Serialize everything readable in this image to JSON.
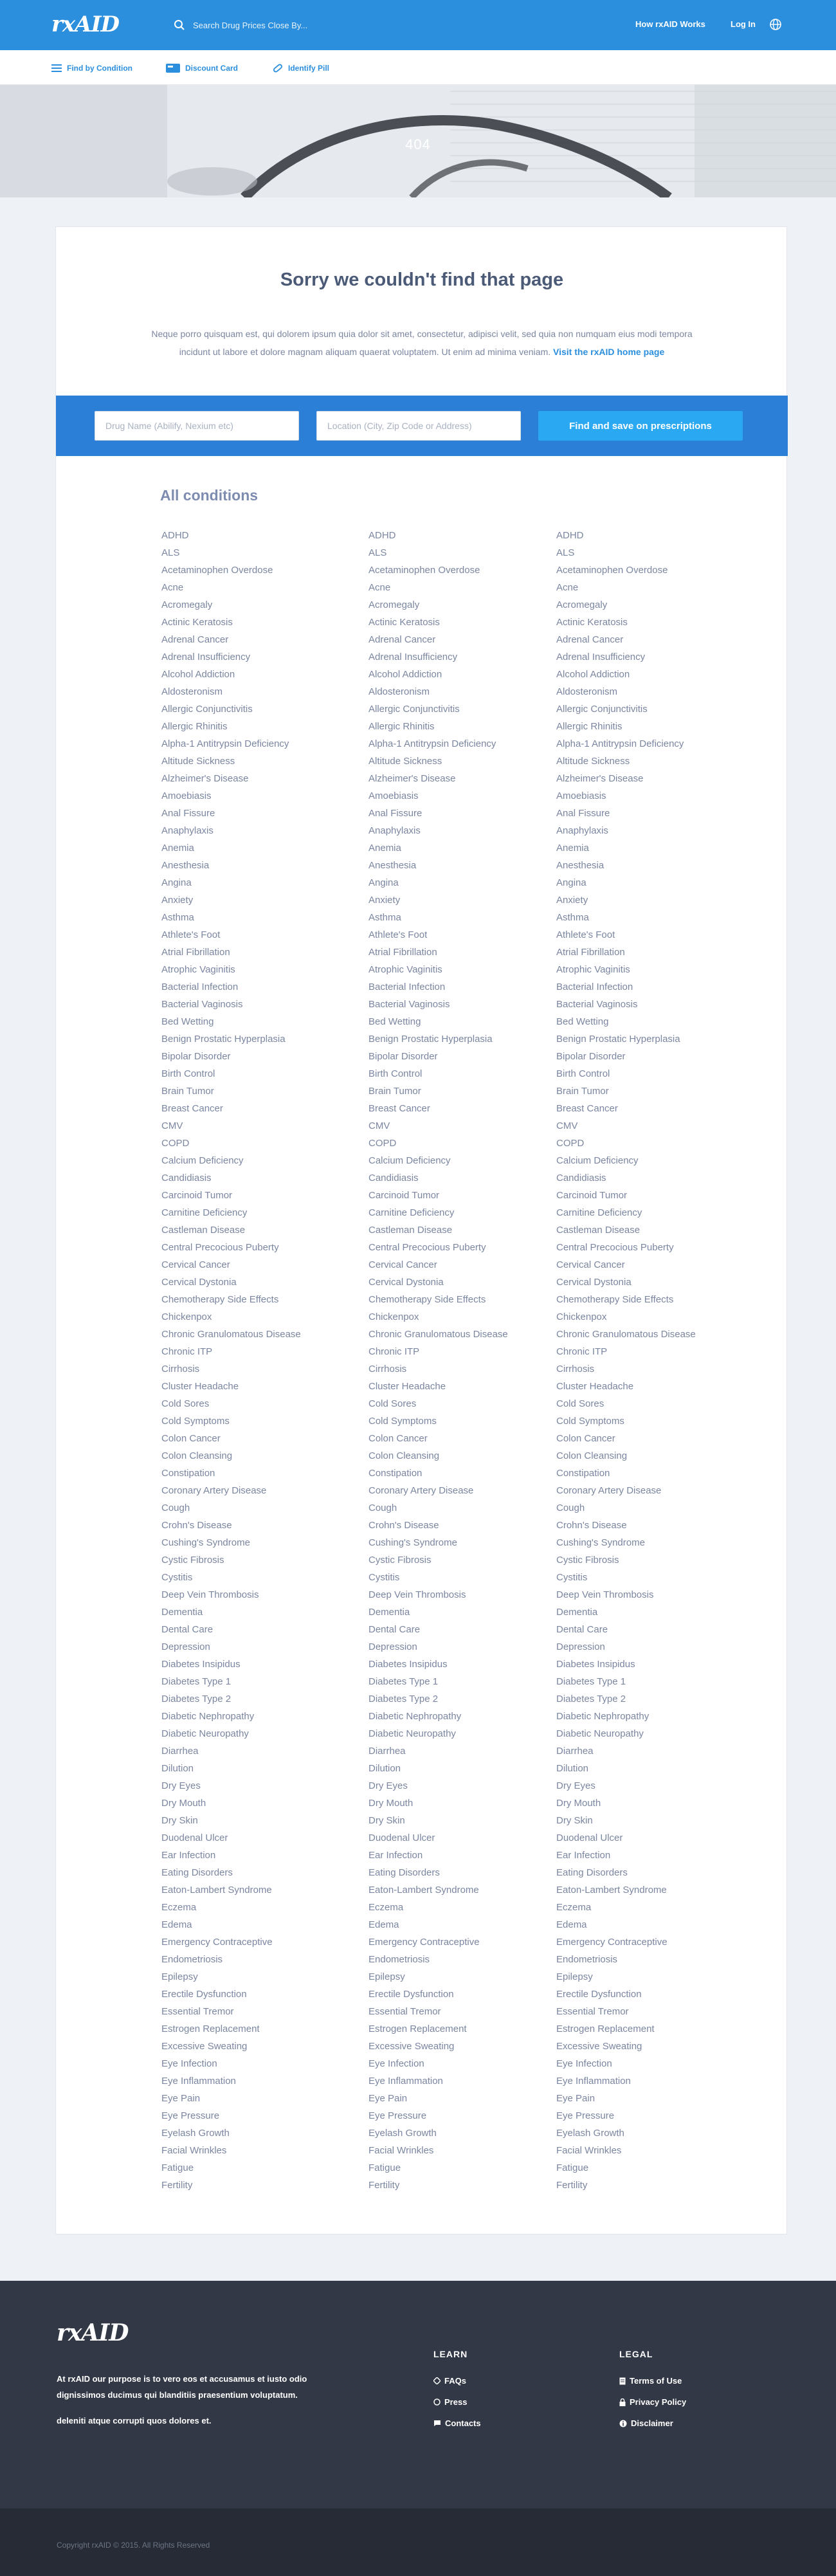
{
  "header": {
    "logo_text": "rxAID",
    "search_placeholder": "Search Drug Prices Close By...",
    "how_it_works": "How rxAID Works",
    "login": "Log In"
  },
  "subnav": {
    "find_by_condition": "Find by Condition",
    "discount_card": "Discount Card",
    "identify_pill": "Identify Pill"
  },
  "hero": {
    "code": "404"
  },
  "main": {
    "title": "Sorry we couldn't find that page",
    "text": "Neque porro quisquam est, qui dolorem ipsum quia dolor sit amet, consectetur, adipisci velit, sed quia non numquam eius modi tempora incidunt ut labore et dolore magnam aliquam quaerat voluptatem. Ut enim ad minima veniam.",
    "home_link": "Visit the rxAID home page"
  },
  "search_band": {
    "drug_placeholder": "Drug Name (Abilify, Nexium etc)",
    "location_placeholder": "Location (City, Zip Code or Address)",
    "button": "Find and save on prescriptions"
  },
  "conditions": {
    "title": "All conditions",
    "items": [
      "ADHD",
      "ALS",
      "Acetaminophen Overdose",
      "Acne",
      "Acromegaly",
      "Actinic Keratosis",
      "Adrenal Cancer",
      "Adrenal Insufficiency",
      "Alcohol Addiction",
      "Aldosteronism",
      "Allergic Conjunctivitis",
      "Allergic Rhinitis",
      "Alpha-1 Antitrypsin Deficiency",
      "Altitude Sickness",
      "Alzheimer's Disease",
      "Amoebiasis",
      "Anal Fissure",
      "Anaphylaxis",
      "Anemia",
      "Anesthesia",
      "Angina",
      "Anxiety",
      "Asthma",
      "Athlete's Foot",
      "Atrial Fibrillation",
      "Atrophic Vaginitis",
      "Bacterial Infection",
      "Bacterial Vaginosis",
      "Bed Wetting",
      "Benign Prostatic Hyperplasia",
      "Bipolar Disorder",
      "Birth Control",
      "Brain Tumor",
      "Breast Cancer",
      "CMV",
      "COPD",
      "Calcium Deficiency",
      "Candidiasis",
      "Carcinoid Tumor",
      "Carnitine Deficiency",
      "Castleman Disease",
      "Central Precocious Puberty",
      "Cervical Cancer",
      "Cervical Dystonia",
      "Chemotherapy Side Effects",
      "Chickenpox",
      "Chronic Granulomatous Disease",
      "Chronic ITP",
      "Cirrhosis",
      "Cluster Headache",
      "Cold Sores",
      "Cold Symptoms",
      "Colon Cancer",
      "Colon Cleansing",
      "Constipation",
      "Coronary Artery Disease",
      "Cough",
      "Crohn's Disease",
      "Cushing's Syndrome",
      "Cystic Fibrosis",
      "Cystitis",
      "Deep Vein Thrombosis",
      "Dementia",
      "Dental Care",
      "Depression",
      "Diabetes Insipidus",
      "Diabetes Type 1",
      "Diabetes Type 2",
      "Diabetic Nephropathy",
      "Diabetic Neuropathy",
      "Diarrhea",
      "Dilution",
      "Dry Eyes",
      "Dry Mouth",
      "Dry Skin",
      "Duodenal Ulcer",
      "Ear Infection",
      "Eating Disorders",
      "Eaton-Lambert Syndrome",
      "Eczema",
      "Edema",
      "Emergency Contraceptive",
      "Endometriosis",
      "Epilepsy",
      "Erectile Dysfunction",
      "Essential Tremor",
      "Estrogen Replacement",
      "Excessive Sweating",
      "Eye Infection",
      "Eye Inflammation",
      "Eye Pain",
      "Eye Pressure",
      "Eyelash Growth",
      "Facial Wrinkles",
      "Fatigue",
      "Fertility"
    ]
  },
  "footer": {
    "logo_text": "rxAID",
    "purpose": "At rxAID our purpose is to vero eos et accusamus et iusto odio dignissimos ducimus qui blanditiis praesentium voluptatum.",
    "purpose2": "deleniti atque corrupti quos dolores et.",
    "learn": {
      "heading": "LEARN",
      "faqs": "FAQs",
      "press": "Press",
      "contacts": "Contacts"
    },
    "legal": {
      "heading": "LEGAL",
      "terms": "Terms of Use",
      "privacy": "Privacy Policy",
      "disclaimer": "Disclaimer"
    },
    "copyright": "Copyright rxAID © 2015. All Rights Reserved"
  },
  "colors": {
    "brand": "#2c8fde",
    "band": "#2c7fd6",
    "button": "#2aa8f2",
    "footer": "#323845"
  }
}
